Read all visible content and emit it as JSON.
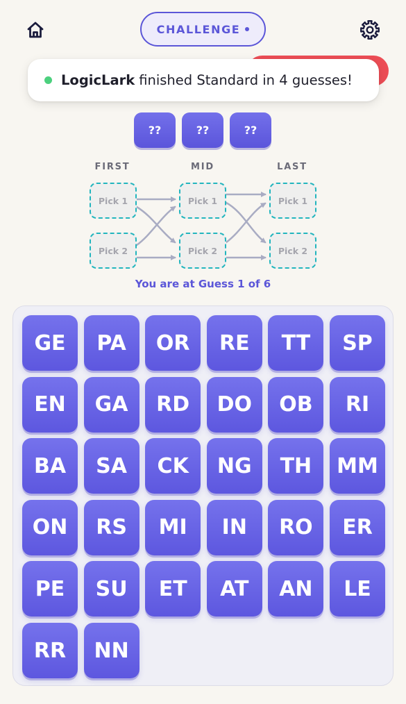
{
  "header": {
    "home_icon": "home-icon",
    "mode_label": "CHALLENGE",
    "settings_icon": "gear-icon"
  },
  "toast": {
    "status_color": "#4cd07e",
    "username": "LogicLark",
    "message": "finished Standard in 4 guesses!"
  },
  "hidden_slots": [
    "??",
    "??",
    "??"
  ],
  "diagram": {
    "columns": [
      "FIRST",
      "MID",
      "LAST"
    ],
    "pick_labels": {
      "first": [
        "Pick 1",
        "Pick 2"
      ],
      "mid": [
        "Pick 1",
        "Pick 2"
      ],
      "last": [
        "Pick 1",
        "Pick 2"
      ]
    }
  },
  "guess_status": "You are at Guess 1 of 6",
  "tiles": [
    "GE",
    "PA",
    "OR",
    "RE",
    "TT",
    "SP",
    "EN",
    "GA",
    "RD",
    "DO",
    "OB",
    "RI",
    "BA",
    "SA",
    "CK",
    "NG",
    "TH",
    "MM",
    "ON",
    "RS",
    "MI",
    "IN",
    "RO",
    "ER",
    "PE",
    "SU",
    "ET",
    "AT",
    "AN",
    "LE",
    "RR",
    "NN"
  ],
  "colors": {
    "accent": "#5b56d8",
    "tile": "#6a65e6",
    "pick_border": "#22b5be",
    "toast_accent": "#ec4d55",
    "background": "#f8f6f1"
  }
}
